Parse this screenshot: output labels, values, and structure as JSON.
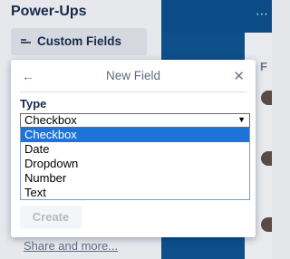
{
  "sidebar": {
    "title": "Power-Ups",
    "custom_fields_button": "Custom Fields",
    "share_link": "Share and more..."
  },
  "board": {
    "more_icon": "⋯",
    "strip_letter": "F"
  },
  "popover": {
    "back_icon": "←",
    "title": "New Field",
    "close_icon": "✕",
    "type_label": "Type",
    "select": {
      "value": "Checkbox",
      "arrow": "▼",
      "options": [
        "Checkbox",
        "Date",
        "Dropdown",
        "Number",
        "Text"
      ]
    },
    "create_button": "Create"
  },
  "colors": {
    "board_blue": "#0d4f8b",
    "selected_option": "#1e73d6",
    "sidebar_bg": "#e6e8ec"
  }
}
